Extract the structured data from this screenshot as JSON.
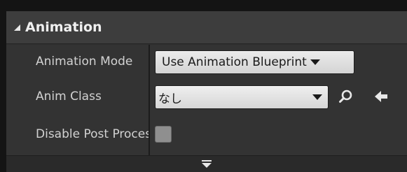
{
  "category": {
    "title": "Animation",
    "expanded": true
  },
  "properties": [
    {
      "label": "Animation Mode",
      "value": "Use Animation Blueprint",
      "control": "dropdown"
    },
    {
      "label": "Anim Class",
      "value": "なし",
      "control": "asset-picker",
      "icons": [
        "search-icon",
        "use-selected-arrow-icon"
      ]
    },
    {
      "label": "Disable Post Process Blueprint",
      "checked": false,
      "control": "checkbox"
    }
  ],
  "footer": {
    "icon": "expand-advanced-icon"
  },
  "colors": {
    "panel_bg": "#2e2e2e",
    "header_bg": "#3d3d3d",
    "label_text": "#d2d2d2",
    "control_bg": "#e0e0e0",
    "icon_color": "#e8e8e8"
  }
}
